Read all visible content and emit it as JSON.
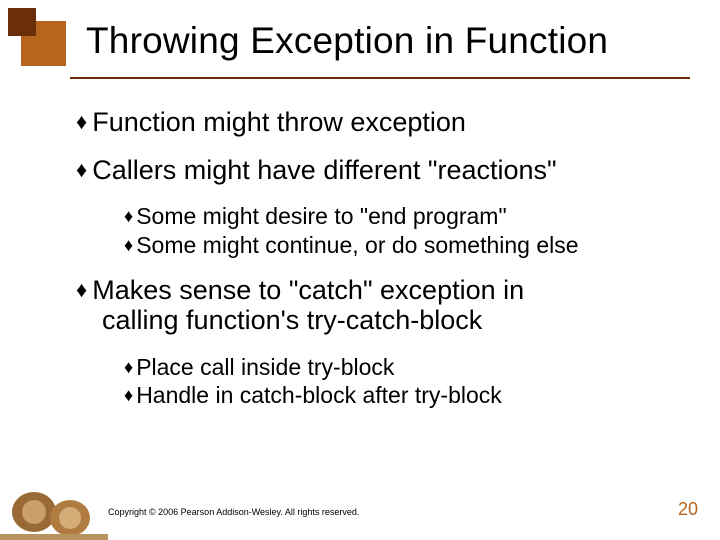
{
  "title": "Throwing Exception in Function",
  "bullets": {
    "b1": "Function might throw exception",
    "b2": "Callers might have different \"reactions\"",
    "b2_subs": {
      "s1": "Some might desire to \"end program\"",
      "s2": "Some might continue, or do something else"
    },
    "b3_line1": "Makes sense to \"catch\" exception in",
    "b3_line2": "calling function's try-catch-block",
    "b3_subs": {
      "s1": "Place call inside try-block",
      "s2": "Handle in catch-block after try-block"
    }
  },
  "glyphs": {
    "diamond": "♦"
  },
  "footer": "Copyright © 2006 Pearson Addison-Wesley. All rights reserved.",
  "pagenum": "20"
}
